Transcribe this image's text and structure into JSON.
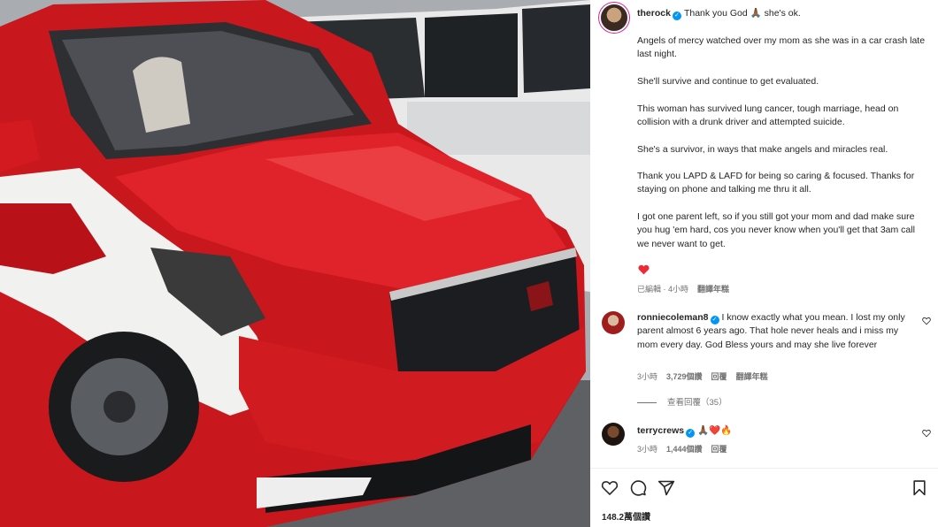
{
  "post": {
    "username": "therock",
    "caption_head": "Thank you God 🙏🏾 she's ok.",
    "paragraphs": [
      "Angels of mercy watched over my mom as she was in a car crash late last night.",
      "She'll survive and continue to get evaluated.",
      "This woman has survived lung cancer, tough marriage, head on collision with a drunk driver and attempted suicide.",
      "She's a survivor, in ways that make angels and miracles real.",
      "Thank you LAPD & LAFD for being so caring & focused. Thanks for staying on phone and talking me thru it all.",
      "I got one parent left, so if you still got your mom and dad make sure you hug 'em hard, cos you never know when you'll get that 3am call we never want to get."
    ],
    "meta_edited": "已編輯 · 4小時",
    "meta_translate": "翻譯年糕"
  },
  "comments": [
    {
      "username": "ronniecoleman8",
      "text": "I know exactly what you mean. I lost my only parent almost 6 years ago. That hole never heals and i miss my mom every day. God Bless yours and may she live forever",
      "time": "3小時",
      "likes": "3,729個讚",
      "reply": "回覆",
      "translate": "翻譯年糕"
    },
    {
      "username": "terrycrews",
      "text": "🙏🏾❤️🔥",
      "time": "3小時",
      "likes": "1,444個讚",
      "reply": "回覆"
    }
  ],
  "view_replies": "查看回覆（35）",
  "likes_total": "148.2萬個讚",
  "icons": [
    "heart-icon",
    "comment-icon",
    "share-icon",
    "bookmark-icon",
    "verified-icon"
  ],
  "colors": {
    "verified": "#0095f6",
    "like_red": "#ed4956",
    "muted": "#737373"
  }
}
